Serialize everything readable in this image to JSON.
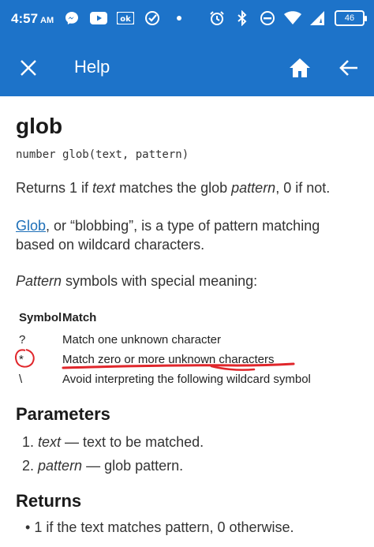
{
  "status": {
    "time": "4:57",
    "ampm": "AM",
    "battery": "46",
    "left_icons": [
      "messenger-icon",
      "youtube-icon",
      "ok-icon",
      "checkmark-icon",
      "dot-icon"
    ],
    "right_icons": [
      "alarm-icon",
      "bluetooth-icon",
      "dnd-icon",
      "wifi-icon",
      "signal-icon",
      "battery-icon"
    ]
  },
  "appbar": {
    "title": "Help",
    "close_icon": "close-icon",
    "home_icon": "home-icon",
    "back_icon": "arrow-left-icon"
  },
  "doc": {
    "title": "glob",
    "signature": "number glob(text, pattern)",
    "desc_pre": "Returns 1 if ",
    "desc_em1": "text",
    "desc_mid": " matches the glob ",
    "desc_em2": "pattern",
    "desc_post": ", 0 if not.",
    "link": "Glob",
    "para_rest": ", or “blobbing”, is a type of pattern matching based on wildcard characters.",
    "pattern_em": "Pattern",
    "pattern_rest": " symbols with special meaning:",
    "table_headers": [
      "Symbol",
      "Match"
    ],
    "table_rows": [
      {
        "symbol": "?",
        "match": "Match one unknown character"
      },
      {
        "symbol": "*",
        "match": "Match zero or more unknown characters"
      },
      {
        "symbol": "\\",
        "match": "Avoid interpreting the following wildcard symbol"
      }
    ],
    "parameters_heading": "Parameters",
    "parameters": [
      {
        "num": "1.",
        "name": "text",
        "desc": " — text to be matched."
      },
      {
        "num": "2.",
        "name": "pattern",
        "desc": " — glob pattern."
      }
    ],
    "returns_heading": "Returns",
    "returns": [
      {
        "bullet": "•",
        "text": "1 if the text matches pattern, 0 otherwise."
      }
    ]
  },
  "colors": {
    "appbar": "#1d73c9",
    "link": "#1d6fb8",
    "annotation": "#e0262b"
  }
}
